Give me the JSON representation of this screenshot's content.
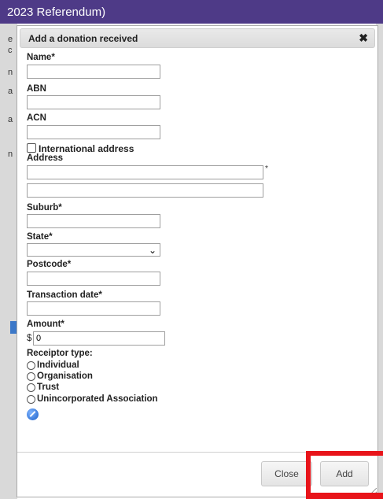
{
  "background": {
    "window_title": "2023 Referendum)",
    "left_fragments": [
      "e",
      "c",
      "n",
      "a",
      "a",
      "n"
    ]
  },
  "dialog": {
    "title": "Add a donation received",
    "close_symbol": "✖",
    "fields": {
      "name": {
        "label": "Name*",
        "value": ""
      },
      "abn": {
        "label": "ABN",
        "value": ""
      },
      "acn": {
        "label": "ACN",
        "value": ""
      },
      "international": {
        "label": "International address",
        "checked": false
      },
      "address": {
        "label": "Address",
        "line1": "",
        "line2": "",
        "required_mark": "*"
      },
      "suburb": {
        "label": "Suburb*",
        "value": ""
      },
      "state": {
        "label": "State*",
        "selected": ""
      },
      "postcode": {
        "label": "Postcode*",
        "value": ""
      },
      "transaction_date": {
        "label": "Transaction date*",
        "value": ""
      },
      "amount": {
        "label": "Amount*",
        "currency": "$",
        "value": "0"
      }
    },
    "receiptor_type": {
      "label": "Receiptor type:",
      "options": [
        "Individual",
        "Organisation",
        "Trust",
        "Unincorporated Association"
      ]
    },
    "icons": {
      "edit": "pencil-icon"
    },
    "buttons": {
      "close": "Close",
      "add": "Add"
    },
    "colors": {
      "title_bar": "#4e3a87",
      "highlight": "#e8141a"
    }
  }
}
